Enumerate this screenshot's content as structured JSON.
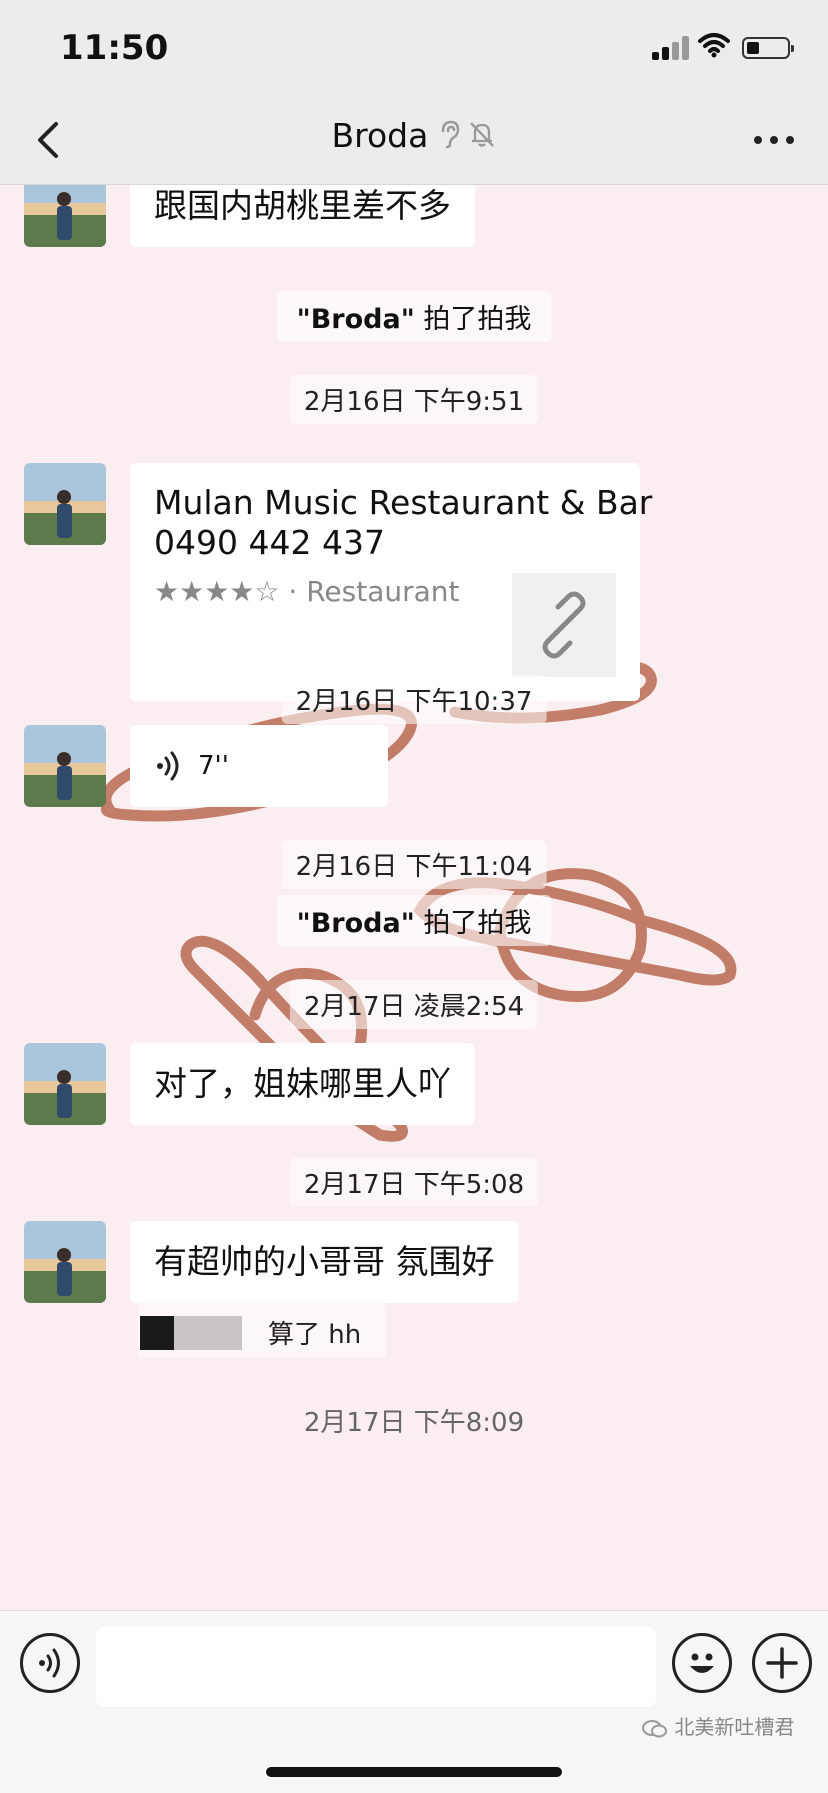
{
  "status_bar": {
    "time": "11:50"
  },
  "header": {
    "title": "Broda",
    "back_icon": "chevron-left-icon",
    "more_icon": "more-dots-icon",
    "status_icons": [
      "ear-icon",
      "muted-bell-icon"
    ]
  },
  "messages": {
    "m1": {
      "text": "跟国内胡桃里差不多"
    },
    "pat1": {
      "name": "\"Broda\"",
      "action": " 拍了拍我"
    },
    "t1": "2月16日 下午9:51",
    "card": {
      "title": "Mulan Music Restaurant & Bar",
      "phone": "0490 442 437",
      "stars": "★★★★☆",
      "category": " · Restaurant",
      "rating": 4
    },
    "t2": "2月16日 下午10:37",
    "voice": {
      "duration": "7''"
    },
    "t3": "2月16日 下午11:04",
    "pat2": {
      "name": "\"Broda\"",
      "action": " 拍了拍我"
    },
    "t4": "2月17日 凌晨2:54",
    "m2": {
      "text": "对了，姐妹哪里人吖"
    },
    "t5": "2月17日 下午5:08",
    "m3": {
      "text": "有超帅的小哥哥 氛围好"
    },
    "reply": {
      "text": "算了 hh"
    },
    "t6_partial": "2月17日 下午8:09"
  },
  "input_bar": {
    "placeholder": "",
    "watermark": "北美新吐槽君"
  },
  "colors": {
    "background": "#fbeef1",
    "doodle": "#b96a52",
    "bubble": "#ffffff"
  }
}
